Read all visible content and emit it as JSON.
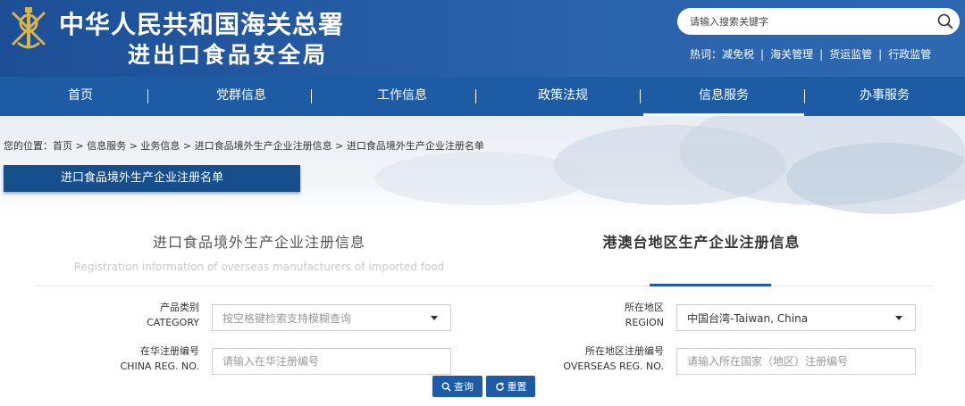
{
  "header": {
    "title_line1": "中华人民共和国海关总署",
    "title_line2": "进出口食品安全局",
    "search": {
      "placeholder": "请输入搜索关键字"
    },
    "hot_label": "热词：",
    "hot_words": [
      "减免税",
      "海关管理",
      "货运监管",
      "行政监管"
    ]
  },
  "nav": {
    "items": [
      "首页",
      "党群信息",
      "工作信息",
      "政策法规",
      "信息服务",
      "办事服务"
    ],
    "active": "信息服务"
  },
  "breadcrumb": "您的位置：首页 > 信息服务 > 业务信息 > 进口食品境外生产企业注册信息 > 进口食品境外生产企业注册名单",
  "section_title": "进口食品境外生产企业注册名单",
  "tabs": {
    "left_zh": "进口食品境外生产企业注册信息",
    "left_en": "Registration information of overseas manufacturers of imported food",
    "right_zh": "港澳台地区生产企业注册信息"
  },
  "form": {
    "category": {
      "label_zh": "产品类别",
      "label_en": "CATEGORY",
      "placeholder": "按空格键检索支持模糊查询"
    },
    "china_reg": {
      "label_zh": "在华注册编号",
      "label_en": "CHINA REG. NO.",
      "placeholder": "请输入在华注册编号"
    },
    "region": {
      "label_zh": "所在地区",
      "label_en": "REGION",
      "value": "中国台湾-Taiwan, China"
    },
    "overseas_reg": {
      "label_zh": "所在地区注册编号",
      "label_en": "OVERSEAS REG. NO.",
      "placeholder": "请输入所在国家（地区）注册编号"
    }
  },
  "buttons": {
    "query": "查询",
    "reset": "重置"
  }
}
